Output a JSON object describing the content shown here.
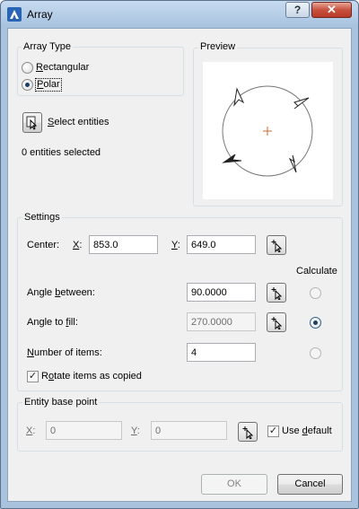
{
  "window": {
    "title": "Array"
  },
  "array_type": {
    "label": "Array Type",
    "rectangular_label": "Rectangular",
    "polar_label": "Polar",
    "selected": "polar"
  },
  "preview": {
    "label": "Preview"
  },
  "select": {
    "button_label": "Select entities",
    "status": "0 entities selected"
  },
  "settings": {
    "label": "Settings",
    "center_label": "Center:",
    "x_label": "X:",
    "x_value": "853.0",
    "y_label": "Y:",
    "y_value": "649.0",
    "calculate_label": "Calculate",
    "angle_between_label": "Angle between:",
    "angle_between_value": "90.0000",
    "angle_to_fill_label": "Angle to fill:",
    "angle_to_fill_value": "270.0000",
    "number_items_label": "Number of items:",
    "number_items_value": "4",
    "rotate_label": "Rotate items as copied",
    "rotate_checked": true,
    "calculate_selected": "angle_to_fill"
  },
  "base_point": {
    "label": "Entity base point",
    "x_label": "X:",
    "x_value": "0",
    "y_label": "Y:",
    "y_value": "0",
    "use_default_label": "Use default",
    "use_default_checked": true
  },
  "buttons": {
    "ok": "OK",
    "cancel": "Cancel"
  }
}
